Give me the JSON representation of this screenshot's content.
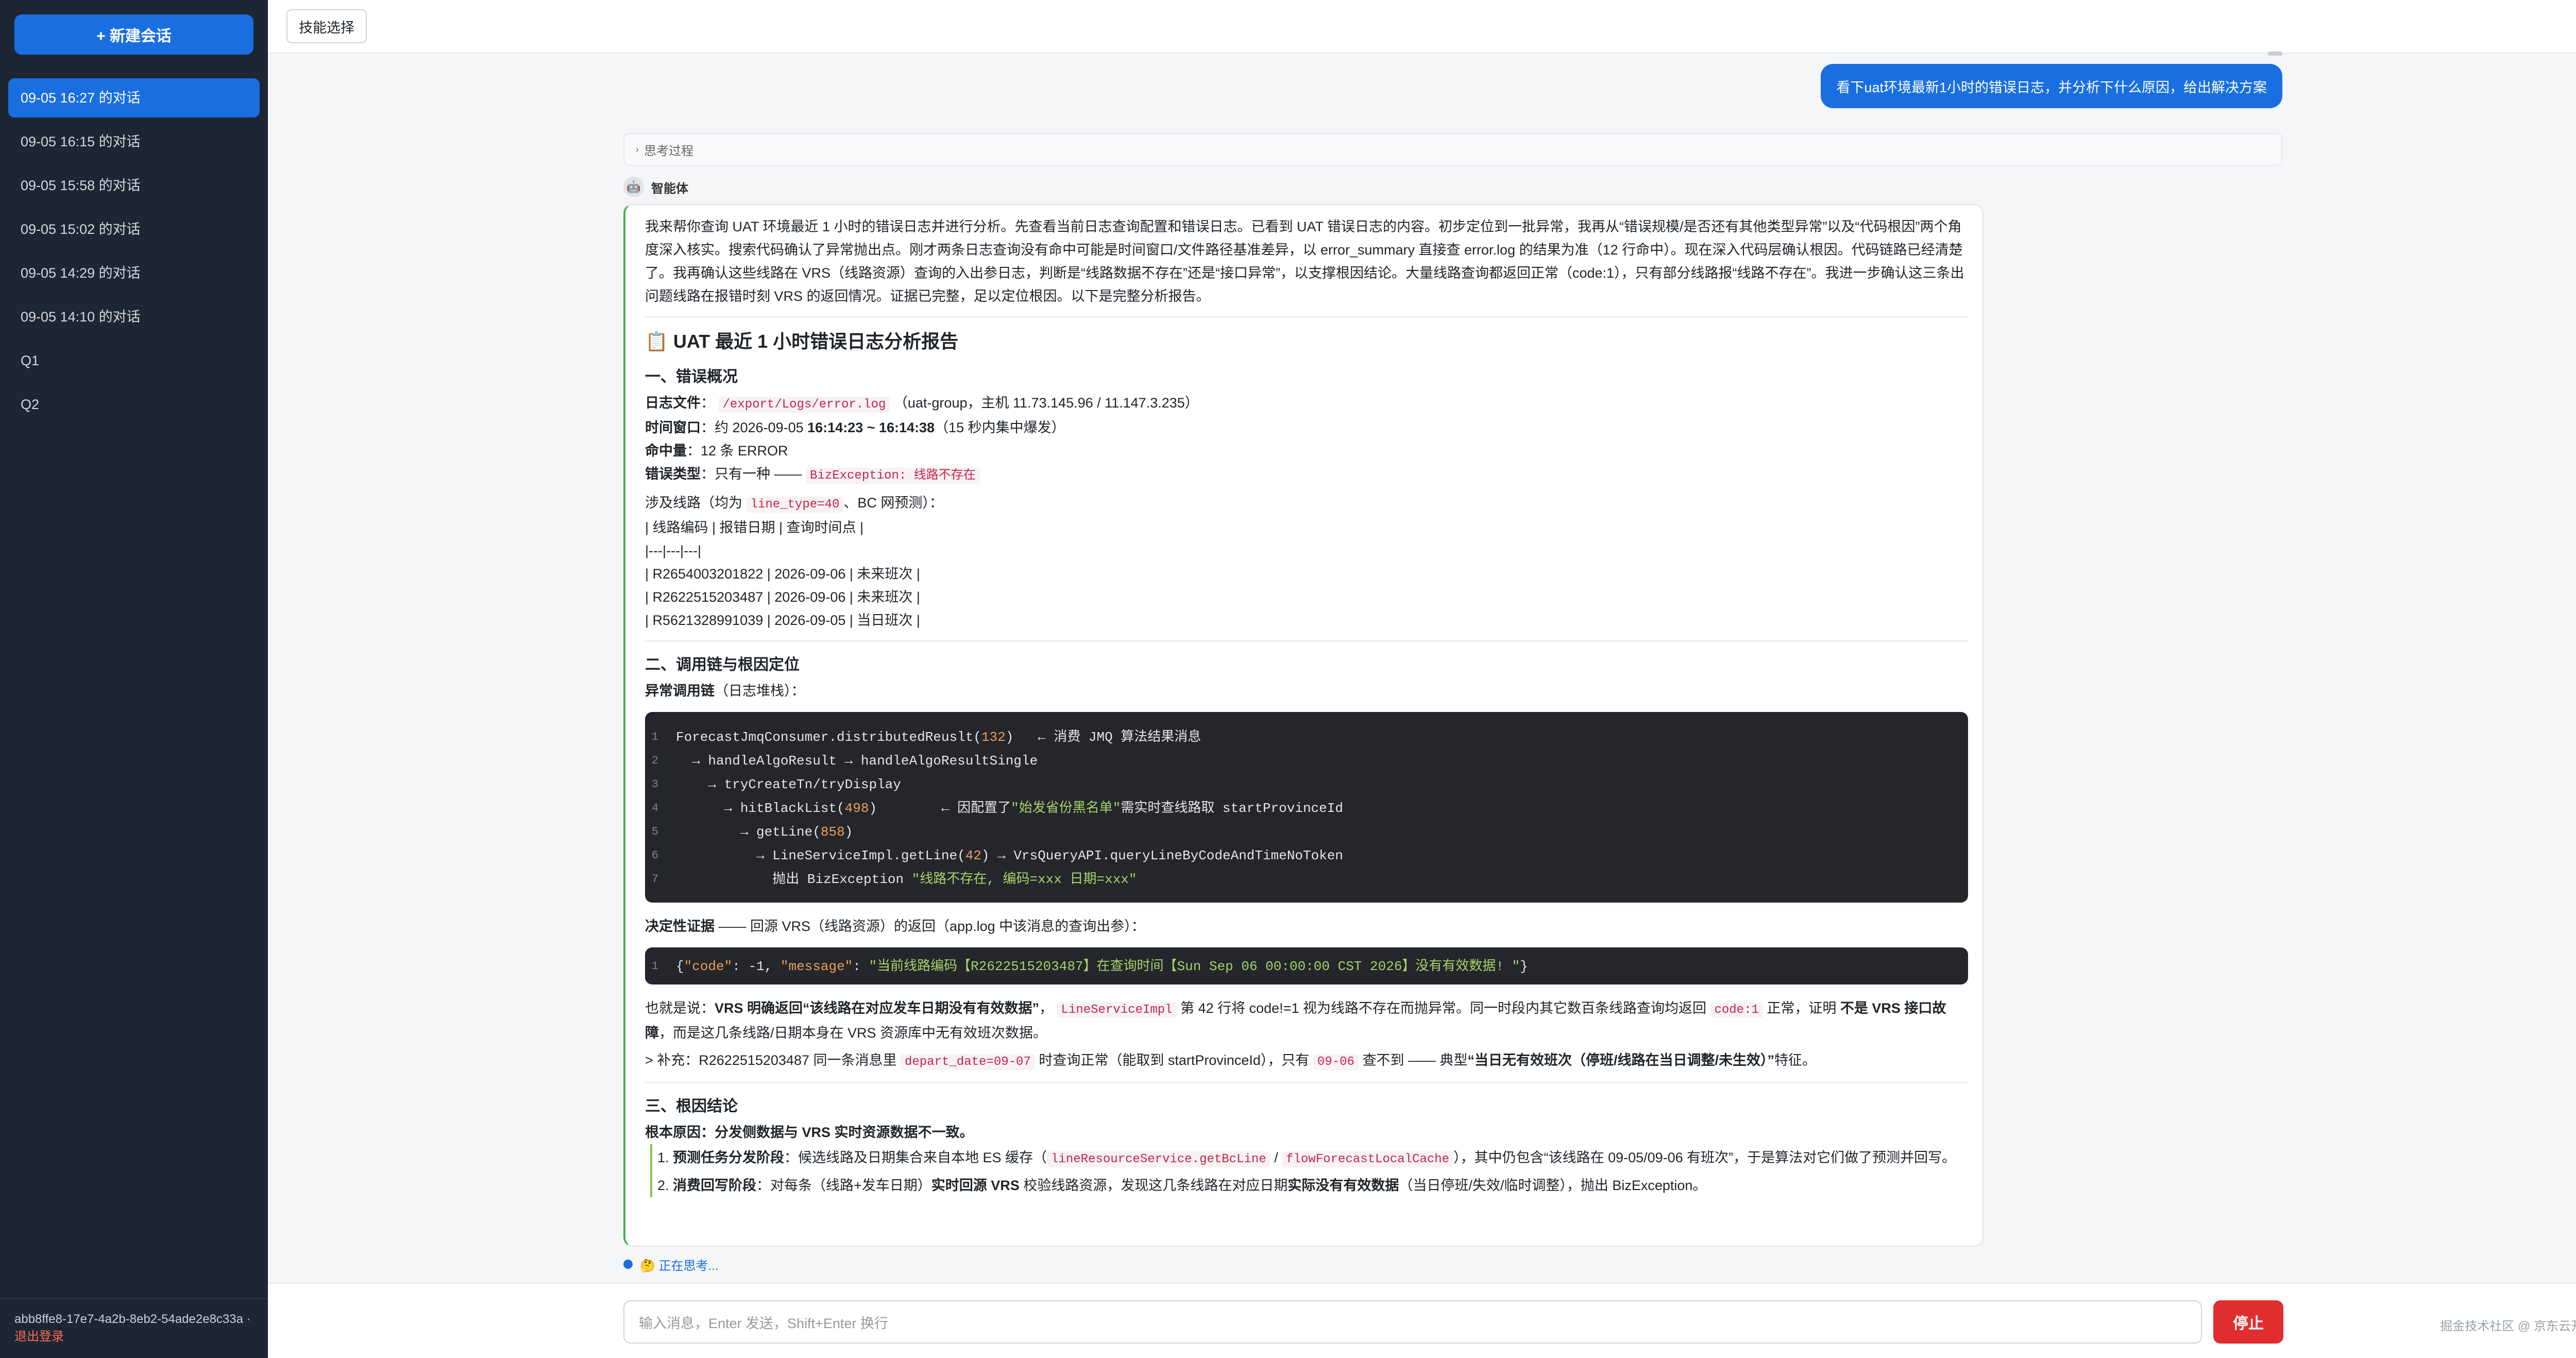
{
  "sidebar": {
    "new_chat": "+ 新建会话",
    "items": [
      "09-05 16:27 的对话",
      "09-05 16:15 的对话",
      "09-05 15:58 的对话",
      "09-05 15:02 的对话",
      "09-05 14:29 的对话",
      "09-05 14:10 的对话",
      "Q1",
      "Q2"
    ],
    "user_id": "abb8ffe8-17e7-4a2b-8eb2-54ade2e8c33a",
    "logout": "退出登录"
  },
  "topbar": {
    "skill_button": "技能选择"
  },
  "user_message": "看下uat环境最新1小时的错误日志，并分析下什么原因，给出解决方案",
  "thinking_label": "思考过程",
  "agent_name": "智能体",
  "answer": {
    "intro": "我来帮你查询 UAT 环境最近 1 小时的错误日志并进行分析。先查看当前日志查询配置和错误日志。已看到 UAT 错误日志的内容。初步定位到一批异常，我再从“错误规模/是否还有其他类型异常”以及“代码根因”两个角度深入核实。搜索代码确认了异常抛出点。刚才两条日志查询没有命中可能是时间窗口/文件路径基准差异，以 error_summary 直接查 error.log 的结果为准（12 行命中）。现在深入代码层确认根因。代码链路已经清楚了。我再确认这些线路在 VRS（线路资源）查询的入出参日志，判断是“线路数据不存在”还是“接口异常”，以支撑根因结论。大量线路查询都返回正常（code:1），只有部分线路报“线路不存在”。我进一步确认这三条出问题线路在报错时刻 VRS 的返回情况。证据已完整，足以定位根因。以下是完整分析报告。",
    "report_title": "📋 UAT 最近 1 小时错误日志分析报告",
    "s1_title": "一、错误概况",
    "s1_logfile_label": "日志文件",
    "s1_logfile_code": "/export/Logs/error.log",
    "s1_logfile_rest": "（uat-group，主机 11.73.145.96 / 11.147.3.235）",
    "s1_window_label": "时间窗口",
    "s1_window_pre": "：约 2026-09-05 ",
    "s1_window_bold": "16:14:23 ~ 16:14:38",
    "s1_window_post": "（15 秒内集中爆发）",
    "s1_hits_label": "命中量",
    "s1_hits_val": "：12 条 ERROR",
    "s1_type_label": "错误类型",
    "s1_type_pre": "：只有一种 —— ",
    "s1_type_code": "BizException: 线路不存在",
    "s1_lines_pre": "涉及线路（均为 ",
    "s1_lines_code": "line_type=40",
    "s1_lines_post": "、BC 网预测）：",
    "table": [
      "| 线路编码 | 报错日期 | 查询时间点 |",
      "|---|---|---|",
      "| R2654003201822 | 2026-09-06 | 未来班次 |",
      "| R2622515203487 | 2026-09-06 | 未来班次 |",
      "| R5621328991039 | 2026-09-05 | 当日班次 |"
    ],
    "s2_title": "二、调用链与根因定位",
    "s2_chain_label": "异常调用链",
    "s2_chain_post": "（日志堆栈）：",
    "code1": [
      {
        "n": "1",
        "parts": [
          [
            "t",
            "ForecastJmqConsumer.distributedReuslt("
          ],
          [
            "num",
            "132"
          ],
          [
            "t",
            ")   ← 消费 JMQ 算法结果消息"
          ]
        ]
      },
      {
        "n": "2",
        "parts": [
          [
            "t",
            "  → handleAlgoResult → handleAlgoResultSingle"
          ]
        ]
      },
      {
        "n": "3",
        "parts": [
          [
            "t",
            "    → tryCreateTn/tryDisplay"
          ]
        ]
      },
      {
        "n": "4",
        "parts": [
          [
            "t",
            "      → hitBlackList("
          ],
          [
            "num",
            "498"
          ],
          [
            "t",
            ")        ← 因配置了"
          ],
          [
            "str",
            "\"始发省份黑名单\""
          ],
          [
            "t",
            "需实时查线路取 startProvinceId"
          ]
        ]
      },
      {
        "n": "5",
        "parts": [
          [
            "t",
            "        → getLine("
          ],
          [
            "num",
            "858"
          ],
          [
            "t",
            ")"
          ]
        ]
      },
      {
        "n": "6",
        "parts": [
          [
            "t",
            "          → LineServiceImpl.getLine("
          ],
          [
            "num",
            "42"
          ],
          [
            "t",
            ") → VrsQueryAPI.queryLineByCodeAndTimeNoToken"
          ]
        ]
      },
      {
        "n": "7",
        "parts": [
          [
            "t",
            "            抛出 BizException "
          ],
          [
            "str",
            "\"线路不存在, 编码=xxx 日期=xxx\""
          ]
        ]
      }
    ],
    "evidence_label": "决定性证据",
    "evidence_post": " —— 回源 VRS（线路资源）的返回（app.log 中该消息的查询出参）：",
    "code2": [
      {
        "n": "1",
        "parts": [
          [
            "t",
            "{"
          ],
          [
            "key",
            "\"code\""
          ],
          [
            "t",
            ": -1, "
          ],
          [
            "key",
            "\"message\""
          ],
          [
            "t",
            ": "
          ],
          [
            "str",
            "\"当前线路编码【R2622515203487】在查询时间【Sun Sep 06 00:00:00 CST 2026】没有有效数据! \""
          ],
          [
            "t",
            "}"
          ]
        ]
      }
    ],
    "conclude_pre": "也就是说：",
    "conclude_b1": "VRS 明确返回“该线路在对应发车日期没有有效数据”",
    "conclude_mid1": "，",
    "conclude_code": "LineServiceImpl",
    "conclude_mid2": " 第 42 行将 code!=1 视为线路不存在而抛异常。同一时段内其它数百条线路查询均返回 ",
    "conclude_code2": "code:1",
    "conclude_mid3": " 正常，证明 ",
    "conclude_b2": "不是 VRS 接口故障",
    "conclude_end": "，而是这几条线路/日期本身在 VRS 资源库中无有效班次数据。",
    "supp_pre": "> 补充：R2622515203487 同一条消息里 ",
    "supp_code1": "depart_date=09-07",
    "supp_mid": " 时查询正常（能取到 startProvinceId），只有 ",
    "supp_code2": "09-06",
    "supp_mid2": " 查不到 —— 典型",
    "supp_bold": "“当日无有效班次（停班/线路在当日调整/未生效）”",
    "supp_end": "特征。",
    "s3_title": "三、根因结论",
    "s3_root_label": "根本原因",
    "s3_root_val": "：分发侧数据与 VRS 实时资源数据不一致。",
    "li1_label": "预测任务分发阶段",
    "li1_pre": "：候选线路及日期集合来自本地 ES 缓存（",
    "li1_code1": "lineResourceService.getBcLine",
    "li1_sep": " / ",
    "li1_code2": "flowForecastLocalCache",
    "li1_post": "），其中仍包含“该线路在 09-05/09-06 有班次”，于是算法对它们做了预测并回写。",
    "li2_label": "消费回写阶段",
    "li2_pre": "：对每条（线路+发车日期）",
    "li2_b1": "实时回源 VRS",
    "li2_mid": " 校验线路资源，发现这几条线路在对应日期",
    "li2_b2": "实际没有有效数据",
    "li2_post": "（当日停班/失效/临时调整），抛出 BizException。"
  },
  "status_text": "🤔 正在思考...",
  "input_placeholder": "输入消息，Enter 发送，Shift+Enter 换行",
  "stop_button": "停止",
  "watermark": "掘金技术社区 @ 京东云开发者"
}
